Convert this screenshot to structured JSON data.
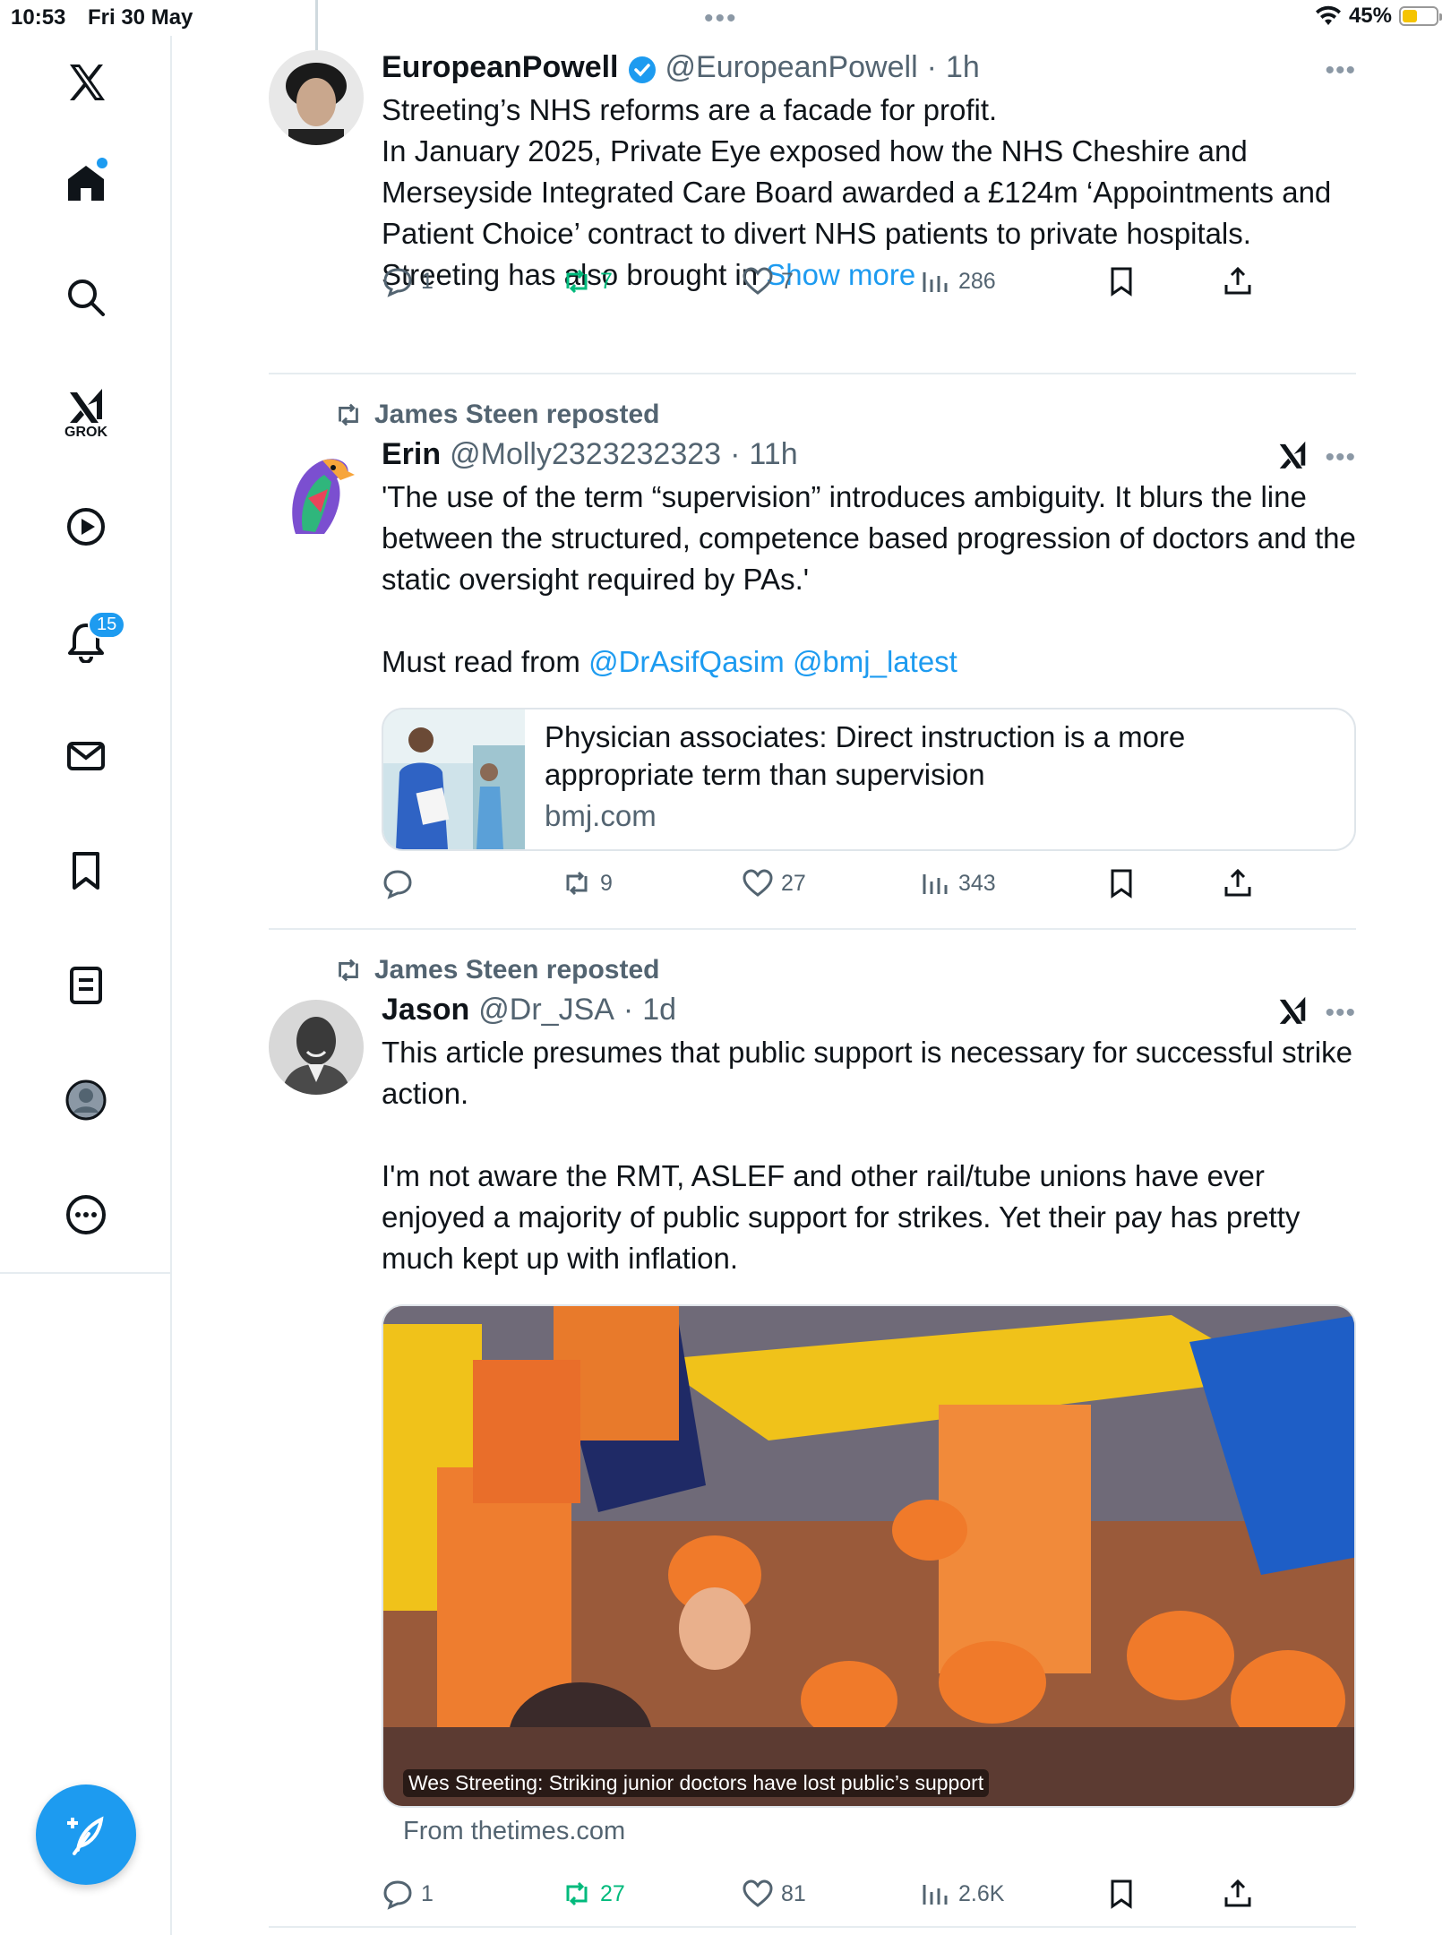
{
  "status_bar": {
    "time": "10:53",
    "date": "Fri 30 May",
    "battery": "45%",
    "battery_level": 0.45
  },
  "sidebar": {
    "items": [
      {
        "icon": "x-logo-icon"
      },
      {
        "icon": "home-icon"
      },
      {
        "icon": "search-icon"
      },
      {
        "icon": "grok-icon",
        "label": "GROK"
      },
      {
        "icon": "video-play-icon"
      },
      {
        "icon": "notifications-bell-icon",
        "badge": "15"
      },
      {
        "icon": "messages-envelope-icon"
      },
      {
        "icon": "bookmarks-icon"
      },
      {
        "icon": "lists-icon"
      },
      {
        "icon": "profile-icon"
      },
      {
        "icon": "more-icon"
      }
    ],
    "compose_icon": "compose-feather-icon"
  },
  "colors": {
    "accent": "#1d9bf0",
    "repost_green": "#00ba7c",
    "muted_text": "#536471",
    "battery_yellow": "#f5c400"
  },
  "tweets": [
    {
      "name": "EuropeanPowell",
      "verified": true,
      "handle": "@EuropeanPowell",
      "time": "1h",
      "text_lines": "Streeting’s NHS reforms are a facade for profit.\nIn January 2025, Private Eye exposed how the NHS Cheshire and Merseyside Integrated Care Board awarded a £124m ‘Appointments and Patient Choice’ contract to divert NHS patients to private hospitals. Streeting has also brought in ",
      "show_more": "Show more",
      "replies": "1",
      "reposts": "7",
      "likes": "7",
      "views": "286"
    },
    {
      "repost_by": "James Steen reposted",
      "name": "Erin",
      "handle": "@Molly2323232323",
      "time": "11h",
      "text_main": "'The use of the term “supervision” introduces ambiguity. It blurs the line between the structured, competence based progression of doctors and the static oversight required by PAs.'\n\nMust read from ",
      "mention_1": "@DrAsifQasim",
      "mention_2": "@bmj_latest",
      "card": {
        "title": "Physician associates: Direct instruction is a more appropriate term than supervision",
        "domain": "bmj.com"
      },
      "replies": "",
      "reposts": "9",
      "likes": "27",
      "views": "343"
    },
    {
      "repost_by": "James Steen reposted",
      "name": "Jason",
      "handle": "@Dr_JSA",
      "time": "1d",
      "text_main": "This article presumes that public support is necessary for successful strike action.\n\nI'm not aware the RMT, ASLEF and other rail/tube unions have ever enjoyed a majority of public support for strikes. Yet their pay has pretty much kept up with inflation.",
      "media_caption": "Wes Streeting: Striking junior doctors have lost public’s support",
      "from": "From thetimes.com",
      "replies": "1",
      "reposts": "27",
      "likes": "81",
      "views": "2.6K"
    }
  ]
}
